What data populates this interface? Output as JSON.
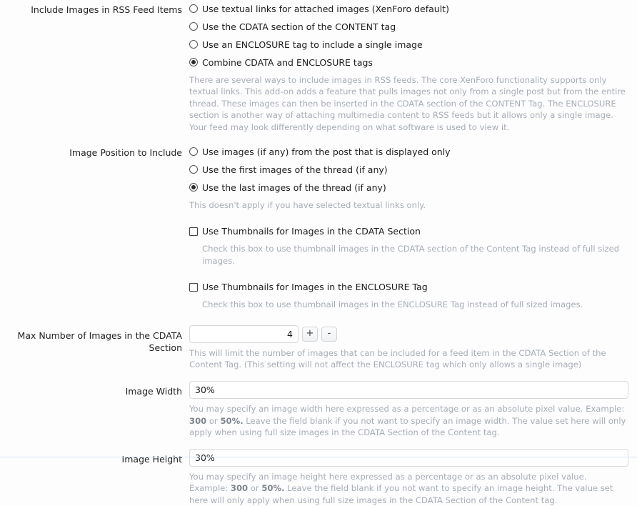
{
  "fields": {
    "include_images": {
      "label": "Include Images in RSS Feed Items",
      "options": [
        {
          "label": "Use textual links for attached images (XenForo default)",
          "selected": false
        },
        {
          "label": "Use the CDATA section of the CONTENT tag",
          "selected": false
        },
        {
          "label": "Use an ENCLOSURE tag to include a single image",
          "selected": false
        },
        {
          "label": "Combine CDATA and ENCLOSURE tags",
          "selected": true
        }
      ],
      "hint": "There are several ways to include images in RSS feeds. The core XenForo functionality supports only textual links. This add-on adds a feature that pulls images not only from a single post but from the entire thread. These images can then be inserted in the CDATA section of the CONTENT Tag. The ENCLOSURE section is another way of attaching multimedia content to RSS feeds but it allows only a single image. Your feed may look differently depending on what software is used to view it."
    },
    "image_position": {
      "label": "Image Position to Include",
      "options": [
        {
          "label": "Use images (if any) from the post that is displayed only",
          "selected": false
        },
        {
          "label": "Use the first images of the thread (if any)",
          "selected": false
        },
        {
          "label": "Use the last images of the thread (if any)",
          "selected": true
        }
      ],
      "hint": "This doesn't apply if you have selected textual links only."
    },
    "thumbnails_cdata": {
      "label": "Use Thumbnails for Images in the CDATA Section",
      "checked": false,
      "hint": "Check this box to use thumbnail images in the CDATA section of the Content Tag instead of full sized images."
    },
    "thumbnails_enclosure": {
      "label": "Use Thumbnails for Images in the ENCLOSURE Tag",
      "checked": false,
      "hint": "Check this box to use thumbnail images in the ENCLOSURE Tag instead of full sized images."
    },
    "max_images": {
      "label": "Max Number of Images in the CDATA Section",
      "value": "4",
      "increment_label": "+",
      "decrement_label": "-",
      "hint": "This will limit the number of images that can be included for a feed item in the CDATA Section of the Content Tag. (This setting will not affect the ENCLOSURE tag which only allows a single image)"
    },
    "image_width": {
      "label": "Image Width",
      "value": "30%",
      "hint_part1": "You may specify an image width here expressed as a percentage or as an absolute pixel value. Example: ",
      "hint_emphasis1": "300",
      "hint_part2": " or ",
      "hint_emphasis2": "50%.",
      "hint_part3": " Leave the field blank if you not want to specify an image width. The value set here will only apply when using full size images in the CDATA Section of the Content tag."
    },
    "image_height": {
      "label": "Image Height",
      "value": "30%",
      "hint_part1": "You may specify an image height here expressed as a percentage or as an absolute pixel value. Example: ",
      "hint_emphasis1": "300",
      "hint_part2": " or ",
      "hint_emphasis2": "50%.",
      "hint_part3": " Leave the field blank if you not want to specify an image height. The value set here will only apply when using full size images in the CDATA Section of the Content tag."
    }
  }
}
